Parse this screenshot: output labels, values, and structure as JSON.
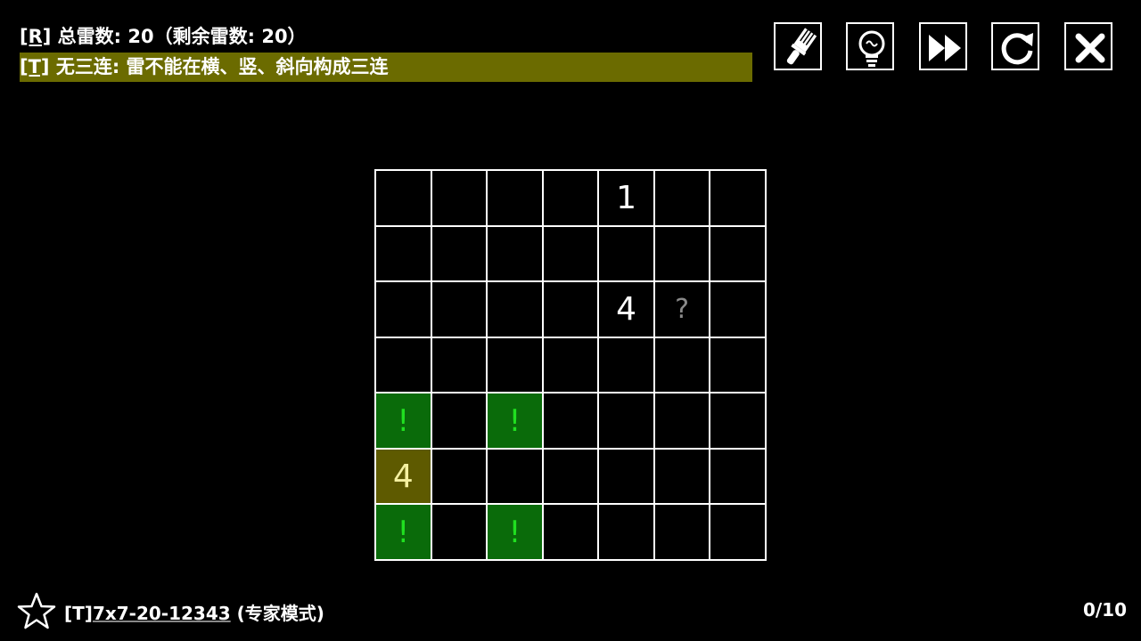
{
  "rules": {
    "r_tag": "[R]",
    "r_text": " 总雷数:  20（剩余雷数: 20）",
    "t_tag": "[T]",
    "t_text": " 无三连: 雷不能在横、竖、斜向构成三连"
  },
  "toolbar": {
    "buttons": [
      {
        "name": "brush",
        "icon": "brush-icon"
      },
      {
        "name": "hint",
        "icon": "lightbulb-icon"
      },
      {
        "name": "skip",
        "icon": "fast-forward-icon"
      },
      {
        "name": "restart",
        "icon": "restart-icon"
      },
      {
        "name": "close",
        "icon": "close-icon"
      }
    ]
  },
  "board": {
    "rows": 7,
    "cols": 7,
    "cells": [
      [
        "",
        "",
        "",
        "",
        "1",
        "",
        ""
      ],
      [
        "",
        "",
        "",
        "",
        "",
        "",
        ""
      ],
      [
        "",
        "",
        "",
        "",
        "4",
        "?",
        ""
      ],
      [
        "",
        "",
        "",
        "",
        "",
        "",
        ""
      ],
      [
        "!",
        "",
        "!",
        "",
        "",
        "",
        ""
      ],
      [
        "4",
        "",
        "",
        "",
        "",
        "",
        ""
      ],
      [
        "!",
        "",
        "!",
        "",
        "",
        "",
        ""
      ]
    ],
    "mine_marker": "!",
    "unknown_marker": "?",
    "selected": [
      5,
      0
    ],
    "colors": {
      "mine_bg": "#0a6b0a",
      "mine_text": "#20e020",
      "selected_bg": "#5e5a00",
      "rule_highlight": "#6b6b00"
    }
  },
  "footer": {
    "star_icon": "star-icon",
    "title_prefix": "[T]",
    "seed": "7x7-20-12343",
    "mode": " (专家模式)",
    "progress": "0/10"
  }
}
